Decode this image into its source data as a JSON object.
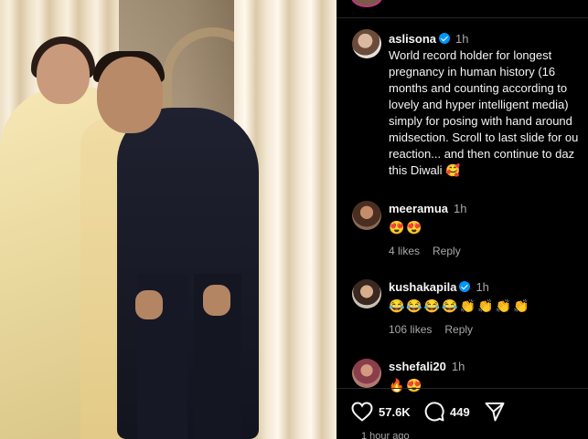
{
  "post": {
    "username": "aslisona",
    "time": "1h",
    "caption_lines": [
      "World record holder for longest",
      "pregnancy in human history (16",
      "months and counting according to",
      "lovely and hyper intelligent media)",
      "simply for posing with hand around",
      "midsection. Scroll to last slide for ou",
      "reaction... and then continue to daz",
      "this Diwali 🥰"
    ]
  },
  "comments": [
    {
      "username": "meeramua",
      "time": "1h",
      "text": "😍😍",
      "likes": "4 likes",
      "reply": "Reply",
      "verified": false
    },
    {
      "username": "kushakapila",
      "time": "1h",
      "text": "😂😂😂😂👏👏👏👏",
      "likes": "106 likes",
      "reply": "Reply",
      "verified": true
    },
    {
      "username": "sshefali20",
      "time": "1h",
      "text": "🔥😍",
      "verified": false
    }
  ],
  "actions": {
    "likes_count": "57.6K",
    "comments_count": "449"
  },
  "timestamp": "1 hour ago",
  "colors": {
    "background": "#000000",
    "secondary_text": "#a8a8a8",
    "verified_blue": "#0095f6",
    "divider": "#262626"
  },
  "icons": [
    "heart-icon",
    "comment-icon",
    "share-icon",
    "verified-icon"
  ]
}
